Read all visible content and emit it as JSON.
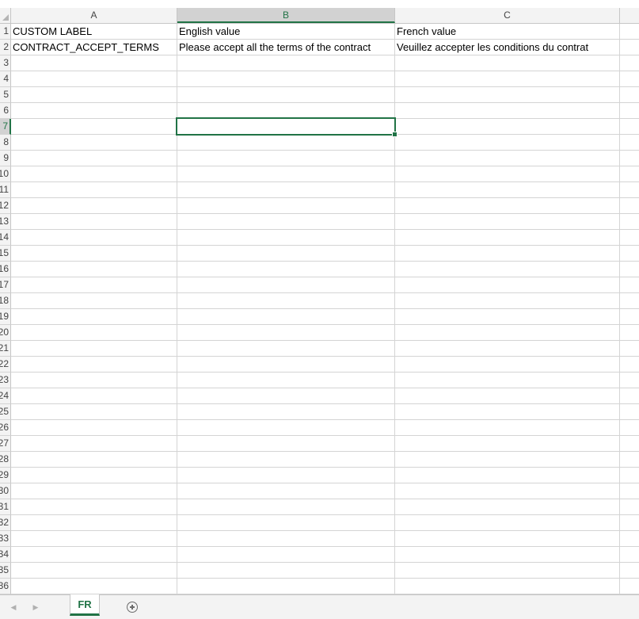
{
  "columns": [
    {
      "label": "A",
      "selected": false
    },
    {
      "label": "B",
      "selected": true
    },
    {
      "label": "C",
      "selected": false
    }
  ],
  "row_numbers": [
    "1",
    "2",
    "3",
    "4",
    "5",
    "6",
    "7",
    "8",
    "9",
    "10",
    "11",
    "12",
    "13",
    "14",
    "15",
    "16",
    "17",
    "18",
    "19",
    "20",
    "21",
    "22",
    "23",
    "24",
    "25",
    "26",
    "27",
    "28",
    "29",
    "30",
    "31",
    "32",
    "33",
    "34",
    "35",
    "36"
  ],
  "selected_row": "7",
  "active_cell": "B7",
  "cells": {
    "A1": "CUSTOM LABEL",
    "B1": "English value",
    "C1": "French value",
    "A2": "CONTRACT_ACCEPT_TERMS",
    "B2": "Please accept all the terms of the contract",
    "C2": "Veuillez accepter les conditions du contrat"
  },
  "sheet_bar": {
    "prev_icon": "triangle-left-icon",
    "next_icon": "triangle-right-icon",
    "active_tab": "FR",
    "add_icon": "plus-circle-icon"
  },
  "colors": {
    "accent": "#217346",
    "header_bg": "#f3f3f3",
    "gridline": "#d4d4d4"
  }
}
